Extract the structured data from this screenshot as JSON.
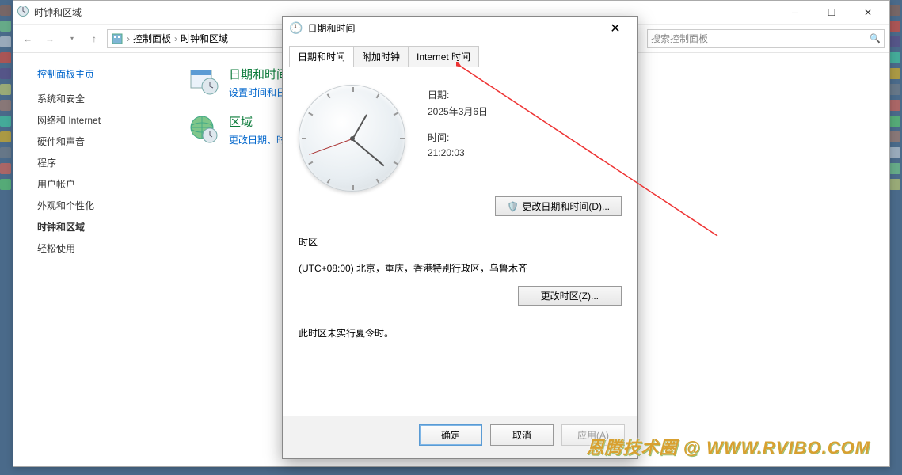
{
  "main_window": {
    "title": "时钟和区域",
    "nav": {
      "back": "←",
      "fwd": "→",
      "up": "↑"
    },
    "breadcrumb": {
      "root": "控制面板",
      "current": "时钟和区域"
    },
    "search_placeholder": "搜索控制面板",
    "sidebar": {
      "header": "控制面板主页",
      "items": [
        {
          "label": "系统和安全"
        },
        {
          "label": "网络和 Internet"
        },
        {
          "label": "硬件和声音"
        },
        {
          "label": "程序"
        },
        {
          "label": "用户帐户"
        },
        {
          "label": "外观和个性化"
        },
        {
          "label": "时钟和区域",
          "active": true
        },
        {
          "label": "轻松使用"
        }
      ]
    },
    "categories": [
      {
        "title": "日期和时间",
        "desc": "设置时间和日期"
      },
      {
        "title": "区域",
        "desc": "更改日期、时间…"
      }
    ]
  },
  "dialog": {
    "title": "日期和时间",
    "tabs": [
      {
        "label": "日期和时间",
        "active": true
      },
      {
        "label": "附加时钟"
      },
      {
        "label": "Internet 时间"
      }
    ],
    "date_label": "日期:",
    "date_value": "2025年3月6日",
    "time_label": "时间:",
    "time_value": "21:20:03",
    "change_datetime": "更改日期和时间(D)...",
    "tz_section": "时区",
    "tz_value": "(UTC+08:00) 北京，重庆，香港特别行政区，乌鲁木齐",
    "change_tz": "更改时区(Z)...",
    "dst_note": "此时区未实行夏令时。",
    "buttons": {
      "ok": "确定",
      "cancel": "取消",
      "apply": "应用(A)"
    }
  },
  "watermark": "恩腾技术圈 @ WWW.RVIBO.COM"
}
